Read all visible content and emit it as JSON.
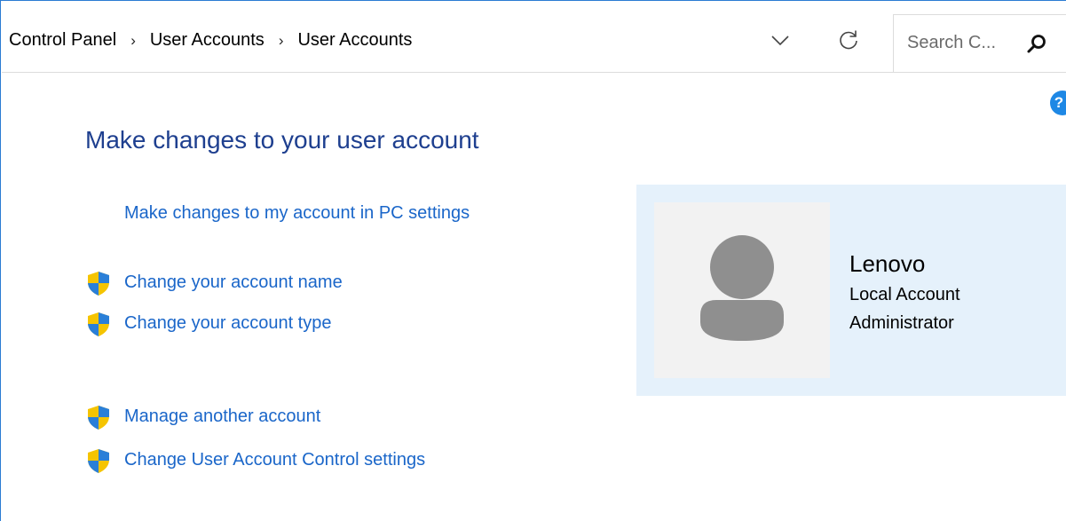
{
  "address_bar": {
    "breadcrumb": [
      "Control Panel",
      "User Accounts",
      "User Accounts"
    ],
    "separator": "›",
    "search_placeholder": "Search C..."
  },
  "main": {
    "heading": "Make changes to your user account",
    "pc_settings_link": "Make changes to my account in PC settings",
    "tasks": [
      {
        "label": "Change your account name",
        "icon": "uac-shield-icon"
      },
      {
        "label": "Change your account type",
        "icon": "uac-shield-icon"
      },
      {
        "label": "Manage another account",
        "icon": "uac-shield-icon"
      },
      {
        "label": "Change User Account Control settings",
        "icon": "uac-shield-icon"
      }
    ]
  },
  "account": {
    "name": "Lenovo",
    "type": "Local Account",
    "role": "Administrator",
    "avatar_icon": "user-avatar-icon"
  },
  "colors": {
    "heading": "#1e3f8f",
    "link": "#1a66c9",
    "card_background": "#e5f1fb",
    "help": "#1e88e5"
  }
}
